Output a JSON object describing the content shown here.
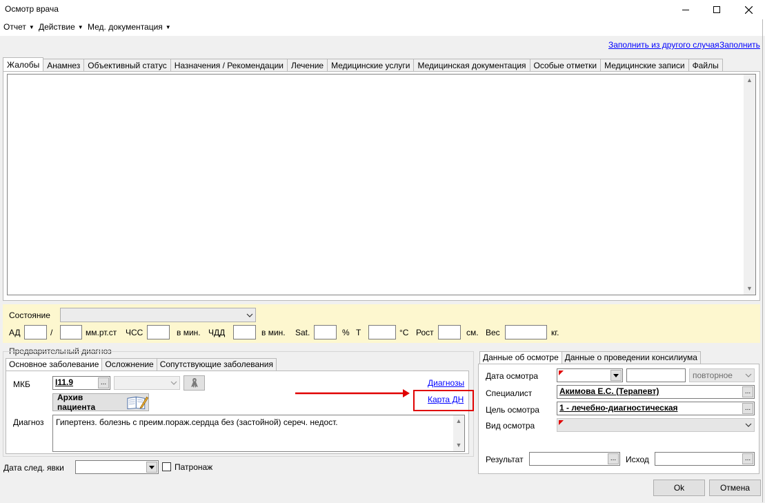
{
  "window": {
    "title": "Осмотр врача"
  },
  "menu": {
    "items": [
      {
        "label": "Отчет"
      },
      {
        "label": "Действие"
      },
      {
        "label": "Мед. документация"
      }
    ]
  },
  "links": {
    "fill_from_other": "Заполнить из другого случая",
    "fill": "Заполнить"
  },
  "tabs": [
    {
      "label": "Жалобы"
    },
    {
      "label": "Анамнез"
    },
    {
      "label": "Объективный статус"
    },
    {
      "label": "Назначения / Рекомендации"
    },
    {
      "label": "Лечение"
    },
    {
      "label": "Медицинские услуги"
    },
    {
      "label": "Медицинская документация"
    },
    {
      "label": "Особые отметки"
    },
    {
      "label": "Медицинские записи"
    },
    {
      "label": "Файлы"
    }
  ],
  "complaints": {
    "value": ""
  },
  "vitals": {
    "state_label": "Состояние",
    "state_value": "",
    "ad_label": "АД",
    "ad_sep": "/",
    "ad_unit": "мм.рт.ст",
    "hr_label": "ЧСС",
    "hr_unit": "в мин.",
    "rr_label": "ЧДД",
    "rr_unit": "в мин.",
    "sat_label": "Sat.",
    "sat_unit": "%",
    "t_label": "Т",
    "t_unit": "°С",
    "height_label": "Рост",
    "height_unit": "см.",
    "weight_label": "Вес",
    "weight_unit": "кг."
  },
  "prelim": {
    "group_label": "Предварительный диагноз",
    "tabs": [
      {
        "label": "Основное заболевание"
      },
      {
        "label": "Осложнение"
      },
      {
        "label": "Сопутствующие заболевания"
      }
    ],
    "mkb_label": "МКБ",
    "mkb_value": "I11.9",
    "archive_button": "Архив пациента",
    "diagnoses_link": "Диагнозы",
    "dn_card_link": "Карта ДН",
    "diagnosis_label": "Диагноз",
    "diagnosis_value": "Гипертенз. болезнь с преим.пораж.сердца без (застойной) сереч. недост."
  },
  "bottom": {
    "next_visit_label": "Дата след. явки",
    "patronage_label": "Патронаж"
  },
  "exam": {
    "tabs": [
      {
        "label": "Данные об осмотре"
      },
      {
        "label": "Данные о проведении консилиума"
      }
    ],
    "date_label": "Дата осмотра",
    "visit_type_value": "повторное",
    "specialist_label": "Специалист",
    "specialist_value": "Акимова Е.С. (Терапевт)",
    "goal_label": "Цель осмотра",
    "goal_value": "1 - лечебно-диагностическая",
    "kind_label": "Вид осмотра",
    "result_label": "Результат",
    "outcome_label": "Исход"
  },
  "buttons": {
    "ok": "Ok",
    "cancel": "Отмена"
  },
  "colors": {
    "highlight_box": "#e00000",
    "arrow": "#e00000",
    "link": "#0000ff",
    "vitals_bg": "#fdf7cf"
  }
}
